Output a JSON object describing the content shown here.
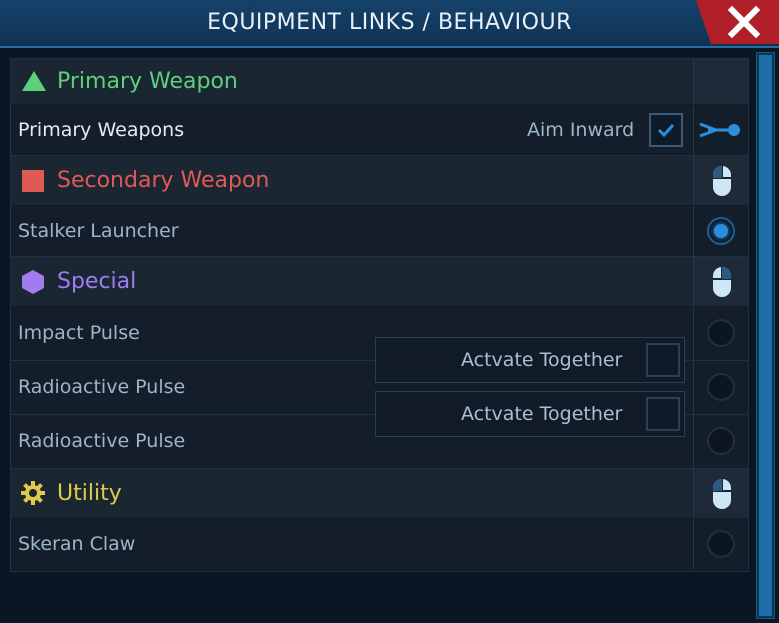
{
  "window": {
    "title": "EQUIPMENT LINKS / BEHAVIOUR",
    "close_symbol": "✕"
  },
  "colors": {
    "primary": "#5fd07a",
    "secondary": "#e05a55",
    "special": "#a07cf0",
    "utility": "#e0c94a",
    "accent": "#2a8ee0"
  },
  "primary": {
    "label": "Primary Weapon",
    "icon": "triangle-icon",
    "item": "Primary Weapons",
    "aim_label": "Aim Inward",
    "aim_checked": true
  },
  "secondary": {
    "label": "Secondary Weapon",
    "icon": "square-icon",
    "items": [
      "Stalker Launcher"
    ]
  },
  "special": {
    "label": "Special",
    "icon": "hexagon-icon",
    "items": [
      "Impact Pulse",
      "Radioactive Pulse",
      "Radioactive Pulse"
    ],
    "together": [
      "Actvate Together",
      "Actvate Together"
    ]
  },
  "utility": {
    "label": "Utility",
    "icon": "gear-icon",
    "items": [
      "Skeran Claw"
    ]
  }
}
